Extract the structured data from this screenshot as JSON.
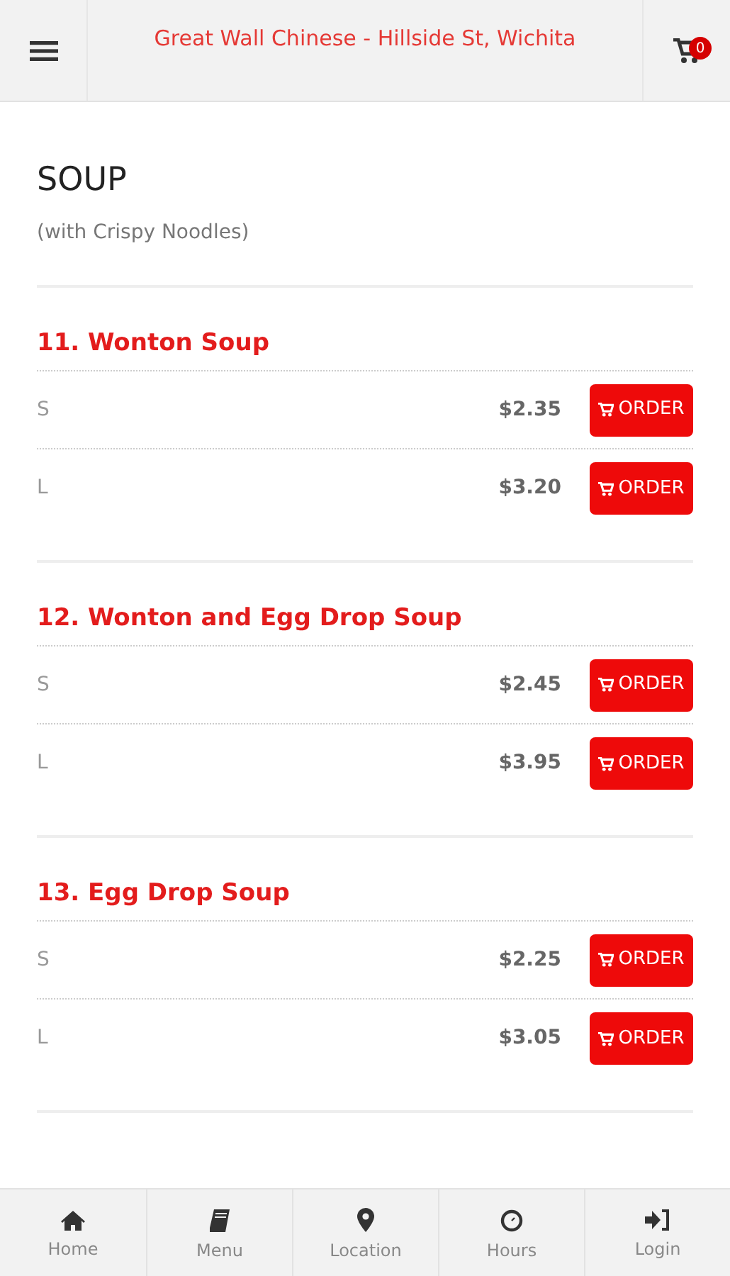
{
  "header": {
    "title": "Great Wall Chinese - Hillside St, Wichita",
    "cart_count": "0"
  },
  "category": {
    "title": "SOUP",
    "subtitle": "(with Crispy Noodles)"
  },
  "items": [
    {
      "name": "11. Wonton Soup",
      "options": [
        {
          "size": "S",
          "price": "$2.35",
          "button": "ORDER"
        },
        {
          "size": "L",
          "price": "$3.20",
          "button": "ORDER"
        }
      ]
    },
    {
      "name": "12. Wonton and Egg Drop Soup",
      "options": [
        {
          "size": "S",
          "price": "$2.45",
          "button": "ORDER"
        },
        {
          "size": "L",
          "price": "$3.95",
          "button": "ORDER"
        }
      ]
    },
    {
      "name": "13. Egg Drop Soup",
      "options": [
        {
          "size": "S",
          "price": "$2.25",
          "button": "ORDER"
        },
        {
          "size": "L",
          "price": "$3.05",
          "button": "ORDER"
        }
      ]
    }
  ],
  "bottom_nav": [
    {
      "label": "Home",
      "kind": "home"
    },
    {
      "label": "Menu",
      "kind": "menu"
    },
    {
      "label": "Location",
      "kind": "location"
    },
    {
      "label": "Hours",
      "kind": "hours"
    },
    {
      "label": "Login",
      "kind": "login"
    }
  ]
}
